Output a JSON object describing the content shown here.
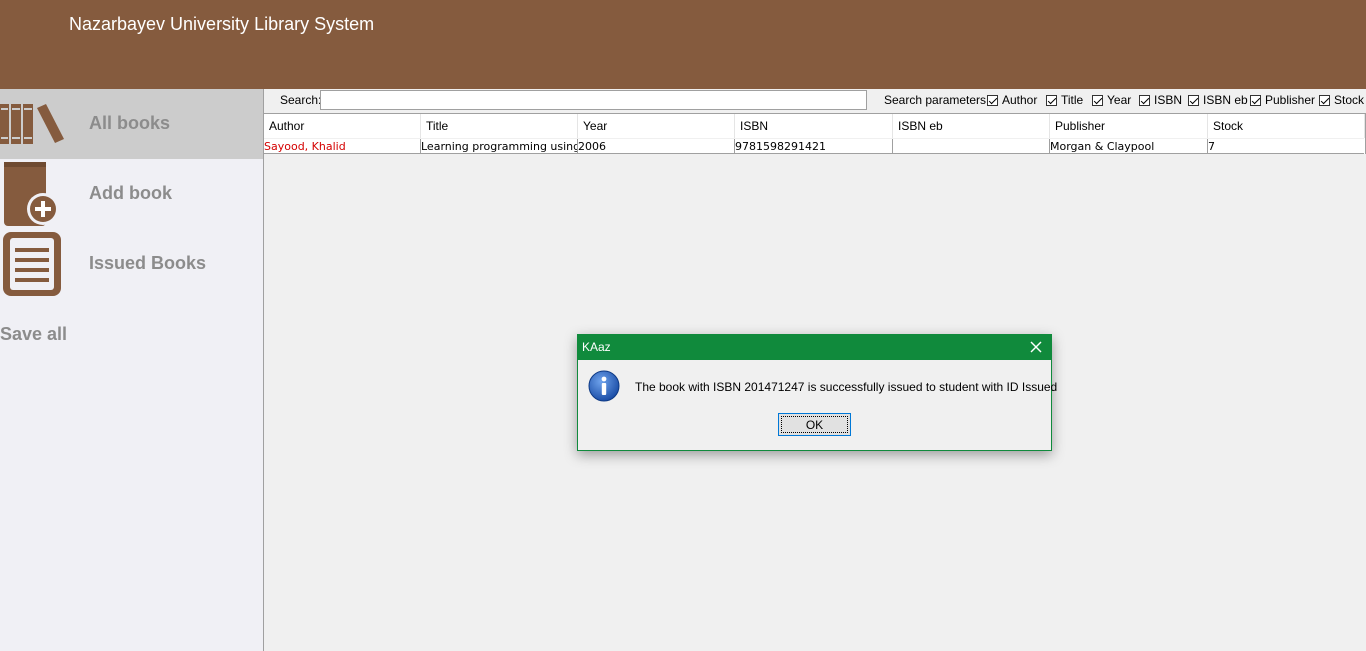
{
  "header": {
    "title": "Nazarbayev University Library System"
  },
  "sidebar": {
    "items": [
      {
        "label": "All books",
        "icon": "books-icon",
        "active": true
      },
      {
        "label": "Add book",
        "icon": "add-book-icon",
        "active": false
      },
      {
        "label": "Issued Books",
        "icon": "list-icon",
        "active": false
      }
    ],
    "save_label": "Save all"
  },
  "search": {
    "label": "Search:",
    "value": "",
    "params_label": "Search parameters:",
    "params": [
      {
        "label": "Author",
        "checked": true
      },
      {
        "label": "Title",
        "checked": true
      },
      {
        "label": "Year",
        "checked": true
      },
      {
        "label": "ISBN",
        "checked": true
      },
      {
        "label": "ISBN eb",
        "checked": true
      },
      {
        "label": "Publisher",
        "checked": true
      },
      {
        "label": "Stock",
        "checked": true
      }
    ]
  },
  "table": {
    "columns": [
      "Author",
      "Title",
      "Year",
      "ISBN",
      "ISBN eb",
      "Publisher",
      "Stock"
    ],
    "rows": [
      [
        "Sayood, Khalid",
        "Learning programming using ...",
        "2006",
        "9781598291421",
        "",
        "Morgan & Claypool",
        "7"
      ]
    ]
  },
  "dialog": {
    "title": "KAaz",
    "message": "The book with ISBN 201471247 is successfully issued to student with ID Issued",
    "ok_label": "OK",
    "icon": "info-icon"
  },
  "colors": {
    "header": "#855b3e",
    "dialog_titlebar": "#108a3c",
    "author_text": "#d40000"
  }
}
